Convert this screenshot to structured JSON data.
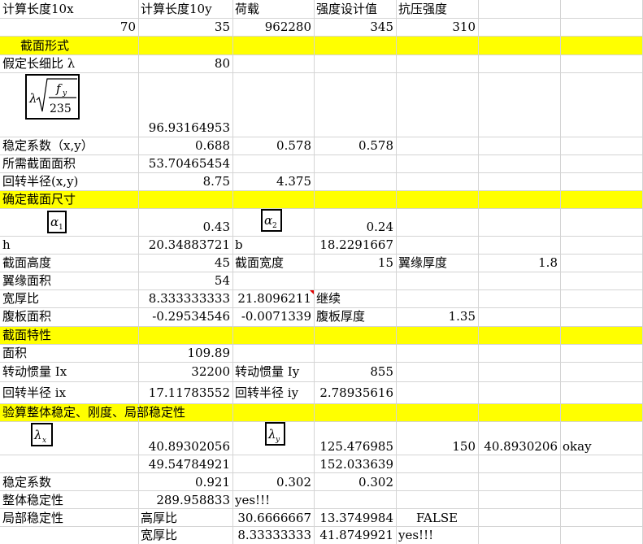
{
  "r0": {
    "a": "计算长度10x",
    "b": "计算长度10y",
    "c": "荷载",
    "d": "强度设计值",
    "e": "抗压强度"
  },
  "r1": {
    "a": "70",
    "b": "35",
    "c": "962280",
    "d": "345",
    "e": "310"
  },
  "r2": {
    "a": "截面形式"
  },
  "r3": {
    "a": "假定长细比 λ",
    "b": "80"
  },
  "formula1": {
    "lambda": "λ",
    "f": "f",
    "y": "y",
    "den": "235"
  },
  "r4": {
    "b": "96.93164953"
  },
  "r5": {
    "a": "稳定系数（x,y）",
    "b": "0.688",
    "c": "0.578",
    "d": "0.578"
  },
  "r6": {
    "a": "所需截面面积",
    "b": "53.70465454"
  },
  "r7": {
    "a": "回转半径(x,y)",
    "b": "8.75",
    "c": "4.375"
  },
  "r8": {
    "a": "确定截面尺寸"
  },
  "alpha1": {
    "sym": "α",
    "sub": "1"
  },
  "alpha2": {
    "sym": "α",
    "sub": "2"
  },
  "r9": {
    "b": "0.43",
    "d": "0.24"
  },
  "r10": {
    "a": "h",
    "b": "20.34883721",
    "c": "b",
    "d": "18.2291667"
  },
  "r11": {
    "a": "截面高度",
    "b": "45",
    "c": "截面宽度",
    "d": "15",
    "e": "翼缘厚度",
    "f": "1.8"
  },
  "r12": {
    "a": "翼缘面积",
    "b": "54"
  },
  "r13": {
    "a": "宽厚比",
    "b": "8.333333333",
    "c": "21.8096211",
    "d": "继续"
  },
  "r14": {
    "a": "腹板面积",
    "b": "-0.29534546",
    "c": "-0.0071339",
    "d": "腹板厚度",
    "e": "1.35"
  },
  "r15": {
    "a": "截面特性"
  },
  "r16": {
    "a": "面积",
    "b": "109.89"
  },
  "r17": {
    "a": "转动惯量 Ix",
    "b": "32200",
    "c": "转动惯量 Iy",
    "d": "855"
  },
  "r18": {
    "a": "回转半径 ix",
    "b": "17.11783552",
    "c": "回转半径 iy",
    "d": "2.78935616"
  },
  "r19": {
    "a": "验算整体稳定、刚度、局部稳定性"
  },
  "lamx": {
    "sym": "λ",
    "sub": "x"
  },
  "lamy": {
    "sym": "λ",
    "sub": "y"
  },
  "r20": {
    "b": "40.89302056",
    "d": "125.476985",
    "e": "150",
    "f": "40.8930206",
    "g": "okay"
  },
  "r21": {
    "b": "49.54784921",
    "d": "152.033639"
  },
  "r22": {
    "a": "稳定系数",
    "b": "0.921",
    "c": "0.302",
    "d": "0.302"
  },
  "r23": {
    "a": "整体稳定性",
    "b": "289.958833",
    "c": "yes!!!"
  },
  "r24": {
    "a": "局部稳定性",
    "b": "高厚比",
    "c": "30.6666667",
    "d": "13.3749984",
    "e": "FALSE"
  },
  "r25": {
    "b": "宽厚比",
    "c": "8.33333333",
    "d": "41.8749921",
    "e": "yes!!!"
  }
}
